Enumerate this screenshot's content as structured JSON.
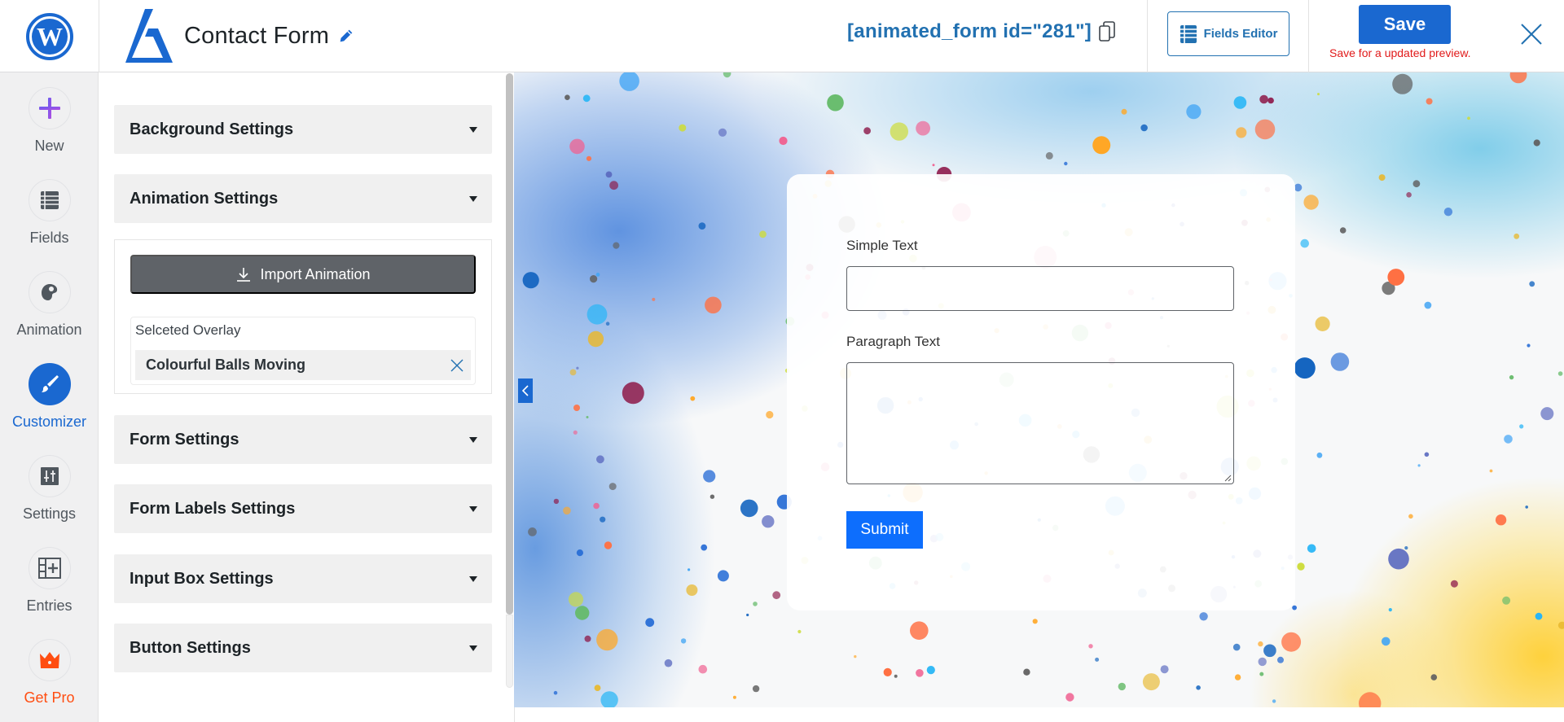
{
  "header": {
    "form_title": "Contact Form",
    "shortcode": "[animated_form id=\"281\"]",
    "fields_editor_label": "Fields Editor",
    "save_label": "Save",
    "save_note": "Save for a updated preview."
  },
  "icons": {
    "wordpress": "wordpress-logo-icon",
    "brand": "animated-forms-logo-icon",
    "edit": "pencil-icon",
    "copy": "copy-icon",
    "fields_editor": "list-icon",
    "close": "close-icon"
  },
  "nav": {
    "items": [
      {
        "label": "New",
        "icon": "plus-icon",
        "active": false
      },
      {
        "label": "Fields",
        "icon": "list-icon",
        "active": false
      },
      {
        "label": "Animation",
        "icon": "palette-icon",
        "active": false
      },
      {
        "label": "Customizer",
        "icon": "brush-icon",
        "active": true
      },
      {
        "label": "Settings",
        "icon": "sliders-icon",
        "active": false
      },
      {
        "label": "Entries",
        "icon": "table-plus-icon",
        "active": false
      },
      {
        "label": "Get Pro",
        "icon": "crown-icon",
        "active": false
      }
    ]
  },
  "panel": {
    "sections": [
      {
        "title": "Background Settings",
        "expanded": false
      },
      {
        "title": "Animation Settings",
        "expanded": true
      },
      {
        "title": "Form Settings",
        "expanded": false
      },
      {
        "title": "Form Labels Settings",
        "expanded": false
      },
      {
        "title": "Input Box Settings",
        "expanded": false
      },
      {
        "title": "Button Settings",
        "expanded": false
      }
    ],
    "animation": {
      "import_label": "Import Animation",
      "overlay_label": "Selceted Overlay",
      "selected_overlay": "Colourful Balls Moving"
    }
  },
  "preview": {
    "background": "watercolor with colourful balls overlay",
    "form": {
      "fields": [
        {
          "label": "Simple Text",
          "type": "text",
          "value": ""
        },
        {
          "label": "Paragraph Text",
          "type": "textarea",
          "value": ""
        }
      ],
      "submit_label": "Submit"
    }
  },
  "colors": {
    "accent": "#1a68d0",
    "shortcode": "#2271b1",
    "save_note": "#e11a1a",
    "pro": "#ff4d11",
    "submit": "#0d6efd",
    "import_button": "#5f6368",
    "new_icon": "#8a4be0"
  }
}
